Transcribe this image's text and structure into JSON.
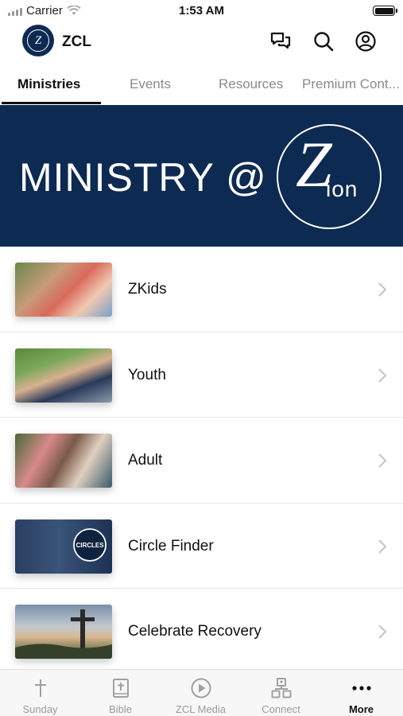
{
  "status_bar": {
    "carrier": "Carrier",
    "time": "1:53 AM",
    "icons": [
      "signal-icon",
      "wifi-icon",
      "battery-icon"
    ]
  },
  "header": {
    "app_name": "ZCL",
    "logo_letter": "Z",
    "icons": [
      "chat-icon",
      "search-icon",
      "profile-icon"
    ]
  },
  "tabs": [
    {
      "label": "Ministries",
      "active": true
    },
    {
      "label": "Events",
      "active": false
    },
    {
      "label": "Resources",
      "active": false
    },
    {
      "label": "Premium Cont...",
      "active": false
    }
  ],
  "banner": {
    "text": "MINISTRY @",
    "logo_text": "Zion",
    "background_color": "#0d2a52"
  },
  "ministries": [
    {
      "label": "ZKids",
      "thumb_icon": "zkids-photo"
    },
    {
      "label": "Youth",
      "thumb_icon": "youth-photo"
    },
    {
      "label": "Adult",
      "thumb_icon": "adult-photo"
    },
    {
      "label": "Circle Finder",
      "thumb_icon": "circles-photo",
      "thumb_text": "CIRCLES"
    },
    {
      "label": "Celebrate Recovery",
      "thumb_icon": "cross-photo"
    }
  ],
  "bottom_nav": [
    {
      "label": "Sunday",
      "icon": "cross-icon",
      "active": false
    },
    {
      "label": "Bible",
      "icon": "bible-icon",
      "active": false
    },
    {
      "label": "ZCL Media",
      "icon": "play-icon",
      "active": false
    },
    {
      "label": "Connect",
      "icon": "connect-icon",
      "active": false
    },
    {
      "label": "More",
      "icon": "more-icon",
      "active": true
    }
  ],
  "colors": {
    "brand_navy": "#0d2a52",
    "text_primary": "#111111",
    "text_muted": "#8a8a8a",
    "nav_background": "#f7f7f7"
  }
}
